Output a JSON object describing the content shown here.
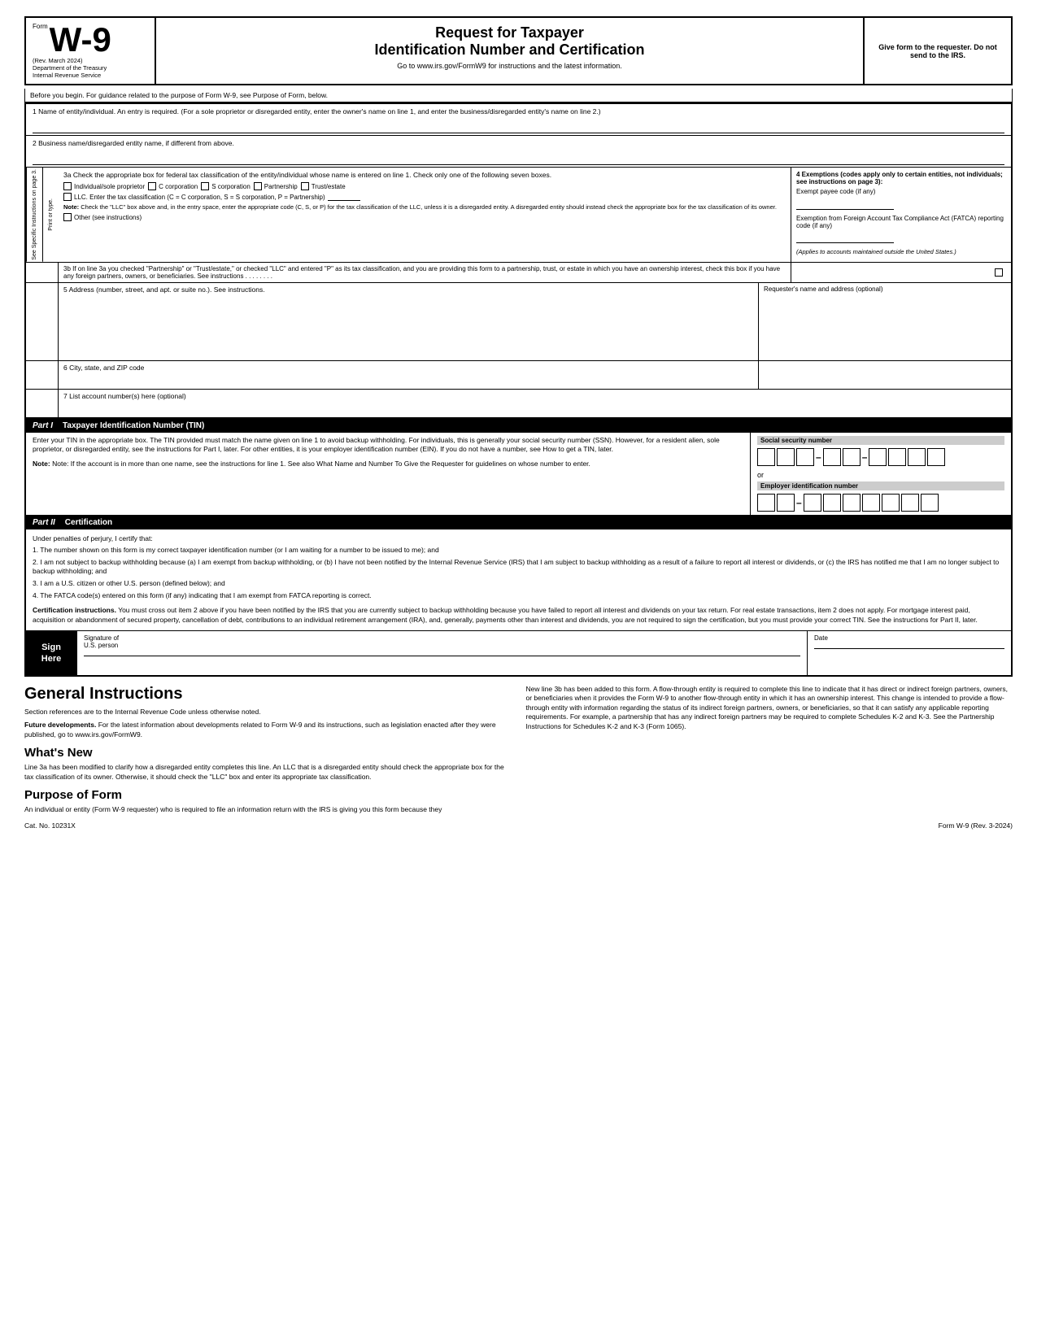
{
  "header": {
    "form_label": "Form",
    "form_number": "W-9",
    "rev_date": "(Rev. March 2024)",
    "dept": "Department of the Treasury",
    "irs": "Internal Revenue Service",
    "title_line1": "Request for Taxpayer",
    "title_line2": "Identification Number and Certification",
    "url_instruction": "Go to www.irs.gov/FormW9 for instructions and the latest information.",
    "give_form": "Give form to the requester. Do not send to the IRS."
  },
  "before_begin": {
    "text": "Before you begin. For guidance related to the purpose of Form W-9, see Purpose of Form, below."
  },
  "fields": {
    "line1_label": "1  Name of entity/individual. An entry is required. (For a sole proprietor or disregarded entity, enter the owner's name on line 1, and enter the business/disregarded entity's name on line 2.)",
    "line2_label": "2  Business name/disregarded entity name, if different from above.",
    "line3a_label": "3a Check the appropriate box for federal tax classification of the entity/individual whose name is entered on line 1. Check only one of the following seven boxes.",
    "cb_individual": "Individual/sole proprietor",
    "cb_c_corp": "C corporation",
    "cb_s_corp": "S corporation",
    "cb_partnership": "Partnership",
    "cb_trust": "Trust/estate",
    "cb_llc": "LLC. Enter the tax classification (C = C corporation, S = S corporation, P = Partnership)",
    "note_text": "Note: Check the \"LLC\" box above and, in the entry space, enter the appropriate code (C, S, or P) for the tax classification of the LLC, unless it is a disregarded entity. A disregarded entity should instead check the appropriate box for the tax classification of its owner.",
    "cb_other": "Other (see instructions)",
    "line4_label": "4  Exemptions (codes apply only to certain entities, not individuals; see instructions on page 3):",
    "exempt_payee": "Exempt payee code (if any)",
    "fatca_label": "Exemption from Foreign Account Tax Compliance Act (FATCA) reporting code (if any)",
    "applies_note": "(Applies to accounts maintained outside the United States.)",
    "line3b_text": "3b If on line 3a you checked \"Partnership\" or \"Trust/estate,\" or checked \"LLC\" and entered \"P\" as its tax classification, and you are providing this form to a partnership, trust, or estate in which you have an ownership interest, check this box if you have any foreign partners, owners, or beneficiaries. See instructions  .  .  .  .  .  .  .  .",
    "line5_label": "5  Address (number, street, and apt. or suite no.). See instructions.",
    "requester_label": "Requester's name and address (optional)",
    "line6_label": "6  City, state, and ZIP code",
    "line7_label": "7  List account number(s) here (optional)"
  },
  "part1": {
    "label": "Part I",
    "title": "Taxpayer Identification Number (TIN)",
    "body_text": "Enter your TIN in the appropriate box. The TIN provided must match the name given on line 1 to avoid backup withholding. For individuals, this is generally your social security number (SSN). However, for a resident alien, sole proprietor, or disregarded entity, see the instructions for Part I, later. For other entities, it is your employer identification number (EIN). If you do not have a number, see How to get a TIN, later.",
    "note_text": "Note: If the account is in more than one name, see the instructions for line 1. See also What Name and Number To Give the Requester for guidelines on whose number to enter.",
    "ssn_label": "Social security number",
    "or_text": "or",
    "ein_label": "Employer identification number"
  },
  "part2": {
    "label": "Part II",
    "title": "Certification",
    "intro": "Under penalties of perjury, I certify that:",
    "items": [
      "1. The number shown on this form is my correct taxpayer identification number (or I am waiting for a number to be issued to me); and",
      "2. I am not subject to backup withholding because (a) I am exempt from backup withholding, or (b) I have not been notified by the Internal Revenue Service (IRS) that I am subject to backup withholding as a result of a failure to report all interest or dividends, or (c) the IRS has notified me that I am no longer subject to backup withholding; and",
      "3. I am a U.S. citizen or other U.S. person (defined below); and",
      "4. The FATCA code(s) entered on this form (if any) indicating that I am exempt from FATCA reporting is correct."
    ],
    "cert_instructions_label": "Certification instructions.",
    "cert_instructions_text": "You must cross out item 2 above if you have been notified by the IRS that you are currently subject to backup withholding because you have failed to report all interest and dividends on your tax return. For real estate transactions, item 2 does not apply. For mortgage interest paid, acquisition or abandonment of secured property, cancellation of debt, contributions to an individual retirement arrangement (IRA), and, generally, payments other than interest and dividends, you are not required to sign the certification, but you must provide your correct TIN. See the instructions for Part II, later."
  },
  "sign_here": {
    "label_line1": "Sign",
    "label_line2": "Here",
    "sig_label": "Signature of",
    "sig_sublabel": "U.S. person",
    "date_label": "Date"
  },
  "general_instructions": {
    "title": "General Instructions",
    "section_refs": "Section references are to the Internal Revenue Code unless otherwise noted.",
    "future_dev_label": "Future developments.",
    "future_dev_text": "For the latest information about developments related to Form W-9 and its instructions, such as legislation enacted after they were published, go to www.irs.gov/FormW9.",
    "whats_new_title": "What's New",
    "whats_new_text": "Line 3a has been modified to clarify how a disregarded entity completes this line. An LLC that is a disregarded entity should check the appropriate box for the tax classification of its owner. Otherwise, it should check the \"LLC\" box and enter its appropriate tax classification.",
    "purpose_title": "Purpose of Form",
    "purpose_text": "An individual or entity (Form W-9 requester) who is required to file an information return with the IRS is giving you this form because they",
    "right_col_text": "New line 3b has been added to this form. A flow-through entity is required to complete this line to indicate that it has direct or indirect foreign partners, owners, or beneficiaries when it provides the Form W-9 to another flow-through entity in which it has an ownership interest. This change is intended to provide a flow-through entity with information regarding the status of its indirect foreign partners, owners, or beneficiaries, so that it can satisfy any applicable reporting requirements. For example, a partnership that has any indirect foreign partners may be required to complete Schedules K-2 and K-3. See the Partnership Instructions for Schedules K-2 and K-3 (Form 1065)."
  },
  "footer": {
    "cat_no": "Cat. No. 10231X",
    "form_label": "Form W-9 (Rev. 3-2024)"
  },
  "side_label": {
    "text": "See Specific Instructions on page 3.",
    "subtext": "Print or type."
  }
}
